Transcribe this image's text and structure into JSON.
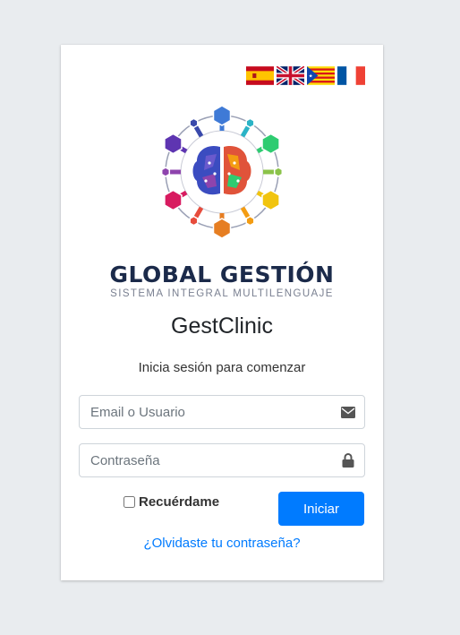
{
  "languages": [
    {
      "name": "flag-es-icon"
    },
    {
      "name": "flag-uk-icon"
    },
    {
      "name": "flag-catalonia-icon"
    },
    {
      "name": "flag-fr-icon"
    }
  ],
  "brand": {
    "title": "GLOBAL GESTIÓN",
    "subtitle": "SISTEMA INTEGRAL MULTILENGUAJE",
    "logo_icon": "brain-logo-icon"
  },
  "app": {
    "title": "GestClinic",
    "message": "Inicia sesión para comenzar"
  },
  "form": {
    "email_placeholder": "Email o Usuario",
    "password_placeholder": "Contraseña",
    "remember_label": "Recuérdame",
    "submit_label": "Iniciar",
    "forgot_label": "¿Olvidaste tu contraseña?"
  },
  "colors": {
    "background": "#e9ecef",
    "primary": "#007bff",
    "brand_dark": "#1b2a4a"
  }
}
